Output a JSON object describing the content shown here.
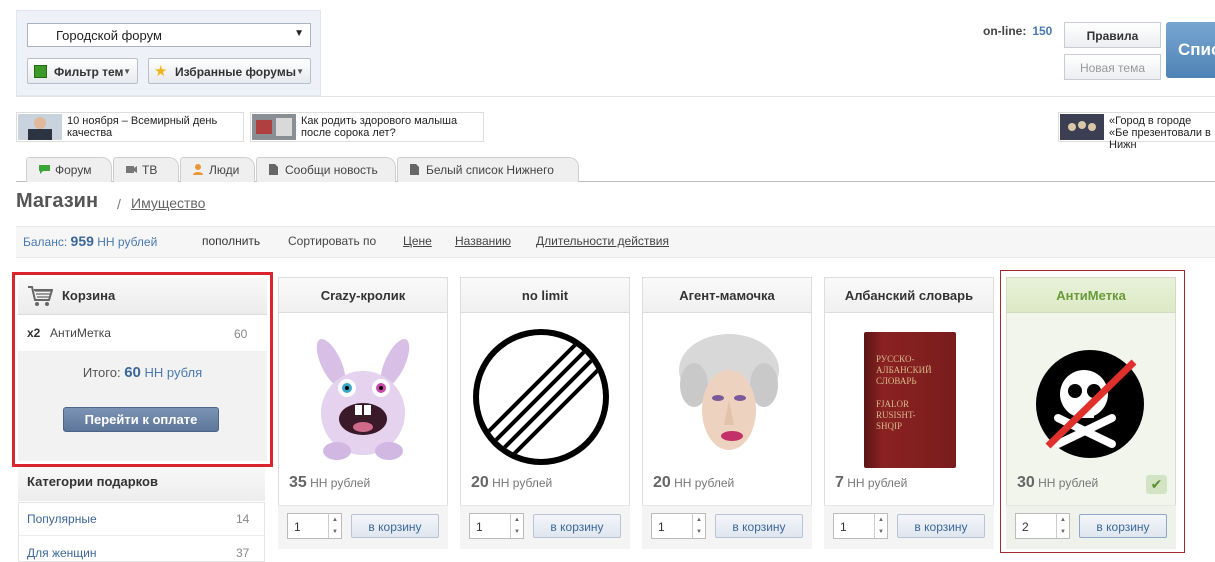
{
  "header": {
    "forum_select": "Городской форум",
    "filter_label": "Фильтр тем",
    "fav_label": "Избранные форумы",
    "online_label": "on-line:",
    "online_count": "150",
    "rules_btn": "Правила",
    "new_topic_btn": "Новая тема",
    "blue_btn": "Спис"
  },
  "news": [
    {
      "text": "10 ноября – Всемирный день качества"
    },
    {
      "text": "Как родить здорового малыша после сорока лет?"
    },
    {
      "text": "«Город в городе «Бе презентовали в Нижн"
    }
  ],
  "tabs": [
    {
      "label": "Форум",
      "icon": "speech-bubble-icon",
      "color": "#3aa63a"
    },
    {
      "label": "ТВ",
      "icon": "camera-icon",
      "color": "#777777"
    },
    {
      "label": "Люди",
      "icon": "person-icon",
      "color": "#e8963a"
    },
    {
      "label": "Сообщи новость",
      "icon": "document-icon",
      "color": "#666666"
    },
    {
      "label": "Белый список Нижнего",
      "icon": "document-icon",
      "color": "#666666"
    }
  ],
  "page": {
    "title": "Магазин",
    "sep": "/",
    "crumb": "Имущество"
  },
  "balance": {
    "label": "Баланс:",
    "amount": "959",
    "currency": "НН рублей",
    "topup": "пополнить"
  },
  "sort": {
    "label": "Сортировать по",
    "options": [
      "Цене",
      "Названию",
      "Длительности действия"
    ]
  },
  "cart": {
    "title": "Корзина",
    "item_qty": "x2",
    "item_name": "АнтиМетка",
    "item_price": "60",
    "total_label": "Итого:",
    "total_amount": "60",
    "total_currency": "НН рубля",
    "pay_btn": "Перейти к оплате"
  },
  "categories": {
    "title": "Категории подарков",
    "items": [
      {
        "name": "Популярные",
        "count": "14"
      },
      {
        "name": "Для женщин",
        "count": "37"
      }
    ]
  },
  "products": [
    {
      "name": "Crazy-кролик",
      "price": "35",
      "currency": "НН рублей",
      "qty": "1",
      "btn": "в корзину"
    },
    {
      "name": "no limit",
      "price": "20",
      "currency": "НН рублей",
      "qty": "1",
      "btn": "в корзину"
    },
    {
      "name": "Агент-мамочка",
      "price": "20",
      "currency": "НН рублей",
      "qty": "1",
      "btn": "в корзину"
    },
    {
      "name": "Албанский словарь",
      "price": "7",
      "currency": "НН рублей",
      "qty": "1",
      "btn": "в корзину",
      "book_text": [
        "РУССКО-",
        "АЛБАНСКИЙ",
        "СЛОВАРЬ",
        "FJALOR",
        "RUSISHT-",
        "SHQIP"
      ]
    },
    {
      "name": "АнтиМетка",
      "price": "30",
      "currency": "НН рублей",
      "qty": "2",
      "btn": "в корзину",
      "selected": true
    }
  ]
}
